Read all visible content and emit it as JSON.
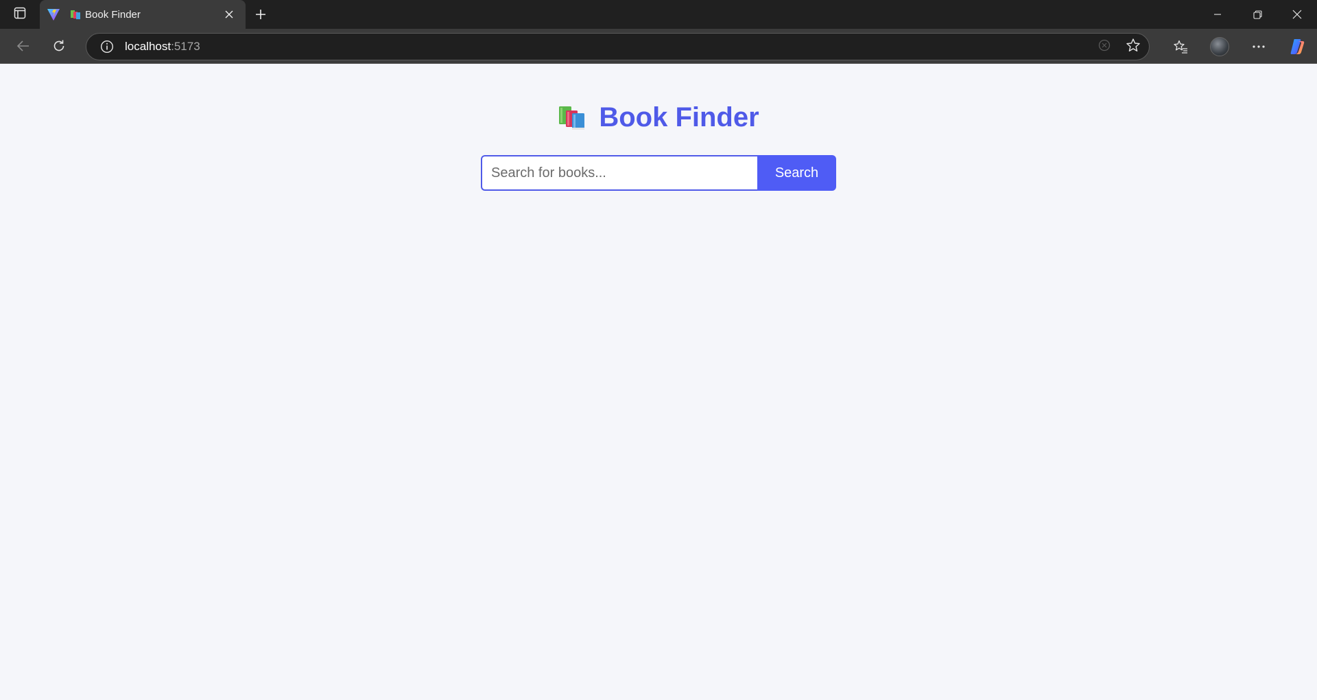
{
  "browser": {
    "tab_title": "Book Finder",
    "url_host": "localhost",
    "url_port": ":5173"
  },
  "icons": {
    "sidebar": "tab-actions-icon",
    "tab_favicon": "books-icon",
    "vite": "vite-logo-icon",
    "close_tab": "close-icon",
    "new_tab": "plus-icon",
    "back": "back-arrow-icon",
    "refresh": "refresh-icon",
    "site_info": "info-icon",
    "favorite": "star-icon",
    "favorites": "favorites-icon",
    "more": "more-icon",
    "copilot": "copilot-icon"
  },
  "app": {
    "title": "Book Finder",
    "search": {
      "placeholder": "Search for books...",
      "value": "",
      "button_label": "Search"
    }
  },
  "colors": {
    "accent": "#4f5ae8",
    "page_background": "#f5f6fa",
    "chrome_dark": "#202020",
    "chrome_toolbar": "#3b3b3b"
  }
}
